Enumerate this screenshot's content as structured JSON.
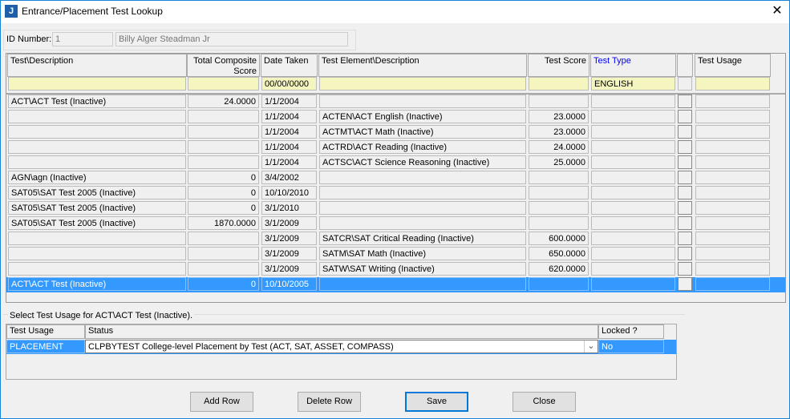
{
  "window": {
    "title": "Entrance/Placement Test Lookup",
    "icon": "J"
  },
  "id": {
    "label": "ID Number:",
    "value": "1",
    "name": "Billy Alger Steadman Jr"
  },
  "grid": {
    "columns": [
      "Test\\Description",
      "Total Composite Score",
      "Date Taken",
      "Test Element\\Description",
      "Test Score",
      "Test Type",
      "",
      "Test Usage"
    ],
    "filter": [
      "",
      "",
      "00/00/0000",
      "",
      "",
      "ENGLISH",
      "",
      ""
    ],
    "rows": [
      [
        "ACT\\ACT Test (Inactive)",
        "24.0000",
        "1/1/2004",
        "",
        "",
        ""
      ],
      [
        "",
        "",
        "1/1/2004",
        "ACTEN\\ACT English (Inactive)",
        "23.0000",
        ""
      ],
      [
        "",
        "",
        "1/1/2004",
        "ACTMT\\ACT Math (Inactive)",
        "23.0000",
        ""
      ],
      [
        "",
        "",
        "1/1/2004",
        "ACTRD\\ACT Reading (Inactive)",
        "24.0000",
        ""
      ],
      [
        "",
        "",
        "1/1/2004",
        "ACTSC\\ACT Science Reasoning (Inactive)",
        "25.0000",
        ""
      ],
      [
        "AGN\\agn (Inactive)",
        "0",
        "3/4/2002",
        "",
        "",
        ""
      ],
      [
        "SAT05\\SAT Test 2005 (Inactive)",
        "0",
        "10/10/2010",
        "",
        "",
        ""
      ],
      [
        "SAT05\\SAT Test 2005 (Inactive)",
        "0",
        "3/1/2010",
        "",
        "",
        ""
      ],
      [
        "SAT05\\SAT Test 2005 (Inactive)",
        "1870.0000",
        "3/1/2009",
        "",
        "",
        ""
      ],
      [
        "",
        "",
        "3/1/2009",
        "SATCR\\SAT Critical Reading (Inactive)",
        "600.0000",
        ""
      ],
      [
        "",
        "",
        "3/1/2009",
        "SATM\\SAT Math (Inactive)",
        "650.0000",
        ""
      ],
      [
        "",
        "",
        "3/1/2009",
        "SATW\\SAT Writing (Inactive)",
        "620.0000",
        ""
      ],
      [
        "ACT\\ACT Test (Inactive)",
        "0",
        "10/10/2005",
        "",
        "",
        ""
      ]
    ],
    "selected_row": 12,
    "test_type_color": "#0000ff"
  },
  "usage": {
    "group_label": "Select Test Usage for ACT\\ACT Test (Inactive).",
    "columns": [
      "Test Usage",
      "Status",
      "Locked ?"
    ],
    "row": {
      "usage": "PLACEMENT",
      "status": "CLPBYTEST College-level Placement by Test (ACT, SAT, ASSET, COMPASS)",
      "locked": "No"
    }
  },
  "buttons": {
    "add": "Add Row",
    "delete": "Delete Row",
    "save": "Save",
    "close": "Close"
  }
}
